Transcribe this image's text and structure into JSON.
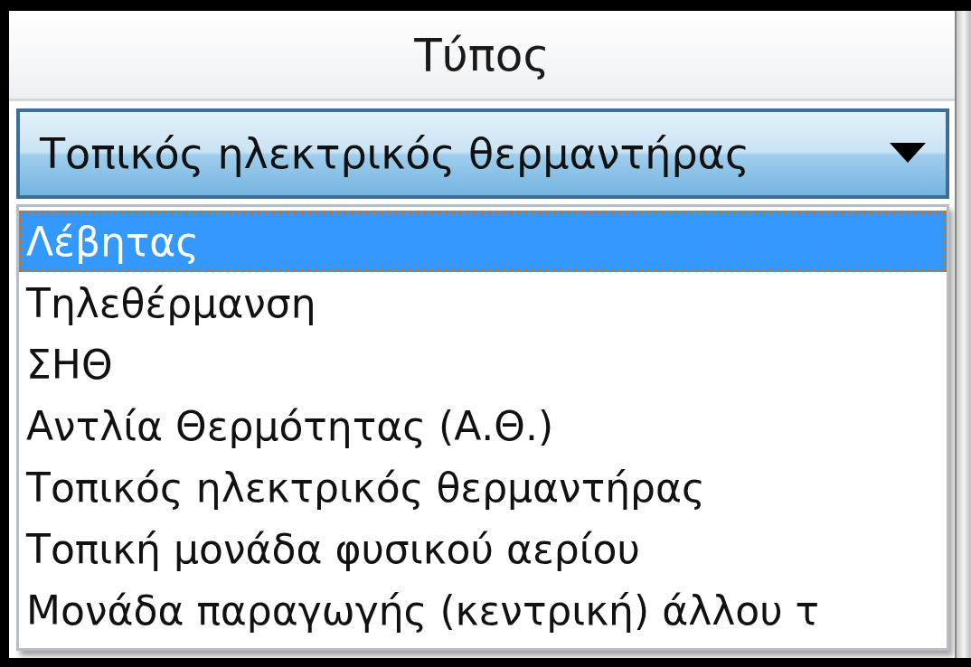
{
  "column_header": "Τύπος",
  "combo": {
    "value": "Τοπικός ηλεκτρικός θερμαντήρας",
    "expanded": true
  },
  "options": [
    {
      "label": "Λέβητας",
      "selected": true
    },
    {
      "label": "Τηλεθέρμανση",
      "selected": false
    },
    {
      "label": "ΣΗΘ",
      "selected": false
    },
    {
      "label": "Αντλία Θερμότητας (Α.Θ.)",
      "selected": false
    },
    {
      "label": "Τοπικός ηλεκτρικός θερμαντήρας",
      "selected": false
    },
    {
      "label": "Τοπική μονάδα φυσικού αερίου",
      "selected": false
    },
    {
      "label": "Μονάδα παραγωγής (κεντρική) άλλου τ",
      "selected": false
    }
  ]
}
